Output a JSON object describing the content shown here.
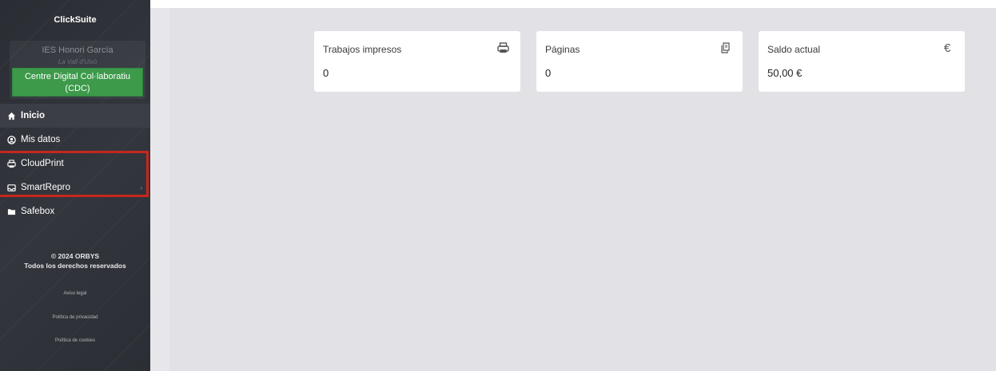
{
  "sidebar": {
    "brand": "ClickSuite",
    "org": {
      "name": "IES Honori García",
      "city": "La Vall d'Uixó",
      "center_button": "Centre Digital Col·laboratiu (CDC)"
    },
    "menu": [
      {
        "label": "Inicio",
        "icon": "home-icon",
        "active": true
      },
      {
        "label": "Mis datos",
        "icon": "user-circle-icon"
      },
      {
        "label": "CloudPrint",
        "icon": "printer-icon"
      },
      {
        "label": "SmartRepro",
        "icon": "inbox-icon",
        "has_submenu": true
      },
      {
        "label": "Safebox",
        "icon": "folder-icon"
      }
    ],
    "copyright_line1": "© 2024 ORBYS",
    "copyright_line2": "Todos los derechos reservados",
    "links": [
      "Aviso legal",
      "Política de privacidad",
      "Política de cookies"
    ]
  },
  "cards": [
    {
      "title": "Trabajos impresos",
      "value": "0",
      "icon": "printer-icon"
    },
    {
      "title": "Páginas",
      "value": "0",
      "icon": "copy-pages-icon"
    },
    {
      "title": "Saldo actual",
      "value": "50,00 €",
      "icon": "euro-icon",
      "icon_glyph": "€"
    }
  ],
  "colors": {
    "sidebar_bg": "#2f3238",
    "accent_green": "#3c9a4a",
    "highlight_red": "#c8261d",
    "page_bg": "#e1e1e6"
  }
}
